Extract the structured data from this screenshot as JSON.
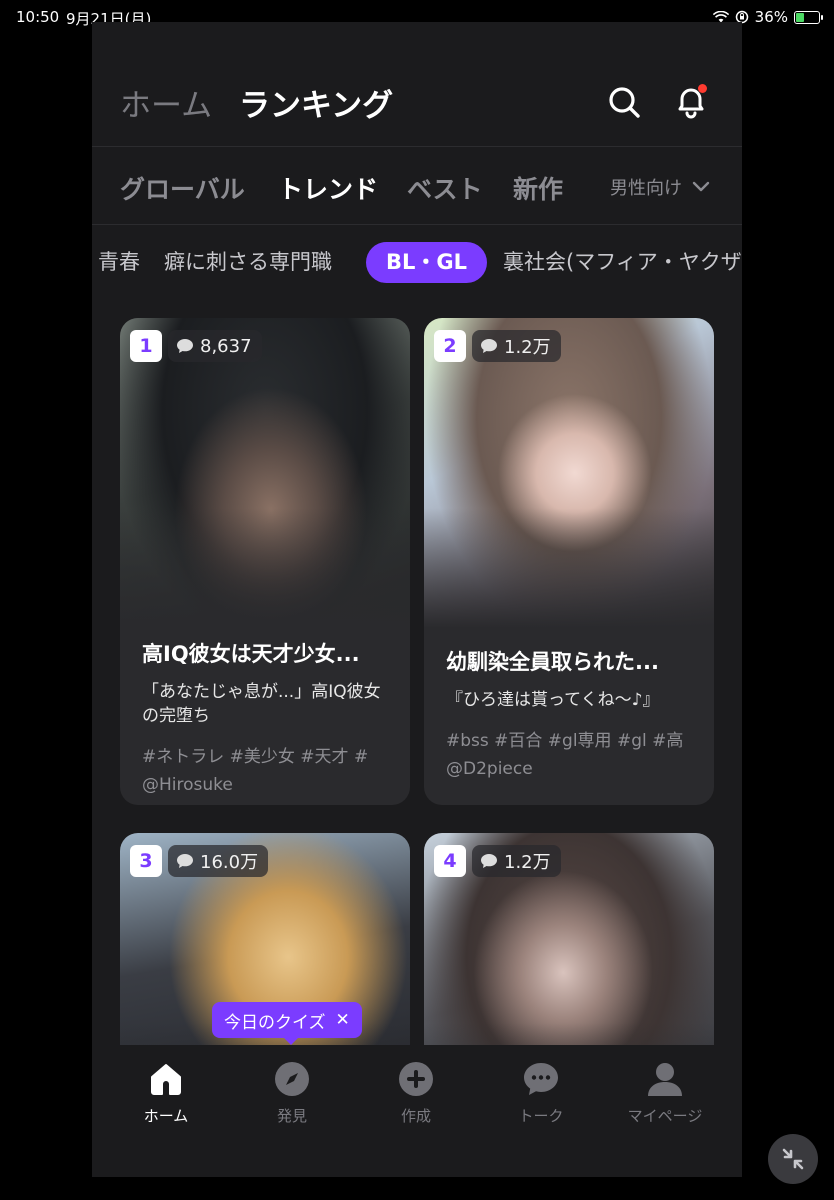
{
  "status_bar": {
    "time": "10:50",
    "date": "9月21日(月)",
    "battery": "36%",
    "battery_level": 0.36
  },
  "header": {
    "tab_home": "ホーム",
    "tab_ranking": "ランキング",
    "search_icon": "search-icon",
    "bell_icon": "bell-icon"
  },
  "rank_tabs": {
    "items": [
      "グローバル",
      "トレンド",
      "ベスト",
      "新作"
    ],
    "active": "トレンド",
    "gender_filter": "男性向け"
  },
  "genres": {
    "items": [
      "青春",
      "癖に刺さる専門職",
      "BL・GL",
      "裏社会(マフィア・ヤクザ"
    ],
    "active": "BL・GL"
  },
  "cards": [
    {
      "rank": "1",
      "comments": "8,637",
      "title": "高IQ彼女は天才少女...",
      "desc": "「あなたじゃ息が...」高IQ彼女の完堕ち",
      "tags": "#ネトラレ #美少女 #天才 #",
      "author": "@Hirosuke"
    },
    {
      "rank": "2",
      "comments": "1.2万",
      "title": "幼馴染全員取られた...",
      "desc": "『ひろ達は貰ってくね〜♪』",
      "tags": "#bss #百合 #gl専用 #gl #高",
      "author": "@D2piece"
    },
    {
      "rank": "3",
      "comments": "16.0万"
    },
    {
      "rank": "4",
      "comments": "1.2万"
    }
  ],
  "quiz": {
    "label": "今日のクイズ",
    "close": "✕"
  },
  "bottom_nav": {
    "items": [
      {
        "label": "ホーム",
        "icon": "home-icon"
      },
      {
        "label": "発見",
        "icon": "compass-icon"
      },
      {
        "label": "作成",
        "icon": "plus-icon"
      },
      {
        "label": "トーク",
        "icon": "chat-icon"
      },
      {
        "label": "マイページ",
        "icon": "person-icon"
      }
    ],
    "active": "ホーム"
  },
  "colors": {
    "accent": "#7b3cff",
    "background": "#1b1b1d",
    "card": "#2a2a2d"
  }
}
